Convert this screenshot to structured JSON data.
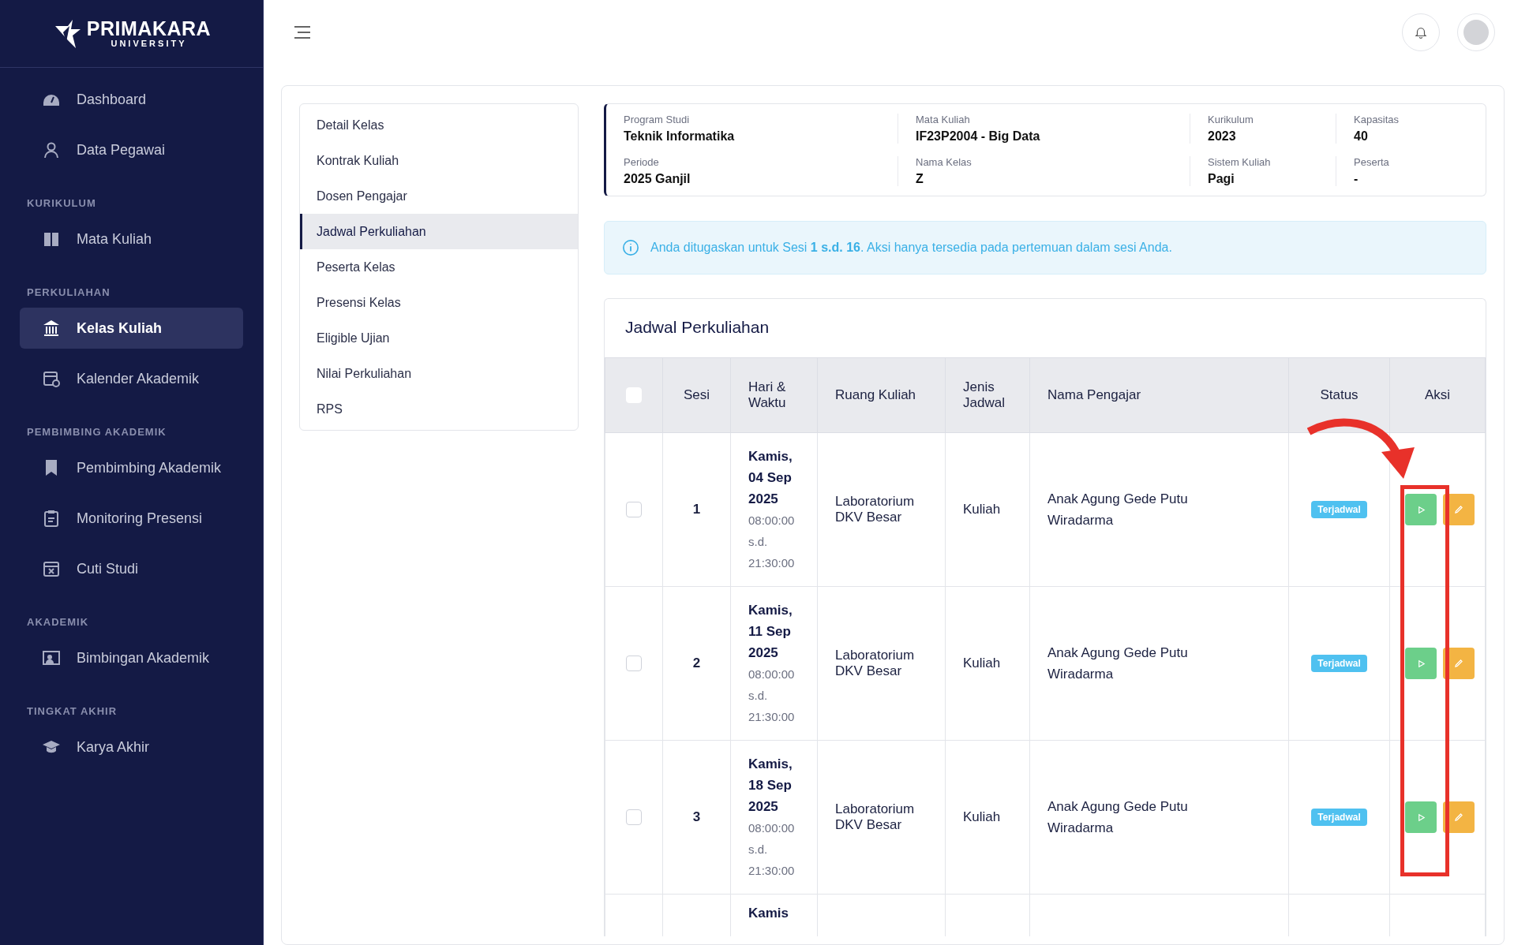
{
  "brand": {
    "name": "PRIMAKARA",
    "subtitle": "UNIVERSITY"
  },
  "sidebar": [
    {
      "items": [
        {
          "label": "Dashboard",
          "kind": "dashboard",
          "selected": false
        },
        {
          "label": "Data Pegawai",
          "kind": "user",
          "selected": false
        }
      ]
    },
    {
      "heading": "KURIKULUM",
      "items": [
        {
          "label": "Mata Kuliah",
          "kind": "book",
          "selected": false
        }
      ]
    },
    {
      "heading": "PERKULIAHAN",
      "items": [
        {
          "label": "Kelas Kuliah",
          "kind": "building",
          "selected": true
        },
        {
          "label": "Kalender Akademik",
          "kind": "calendar",
          "selected": false
        }
      ]
    },
    {
      "heading": "PEMBIMBING AKADEMIK",
      "items": [
        {
          "label": "Pembimbing Akademik",
          "kind": "bookmark",
          "selected": false
        },
        {
          "label": "Monitoring Presensi",
          "kind": "clipboard",
          "selected": false
        },
        {
          "label": "Cuti Studi",
          "kind": "calendar-x",
          "selected": false
        }
      ]
    },
    {
      "heading": "AKADEMIK",
      "items": [
        {
          "label": "Bimbingan Akademik",
          "kind": "board",
          "selected": false
        }
      ]
    },
    {
      "heading": "TINGKAT AKHIR",
      "items": [
        {
          "label": "Karya Akhir",
          "kind": "cap",
          "selected": false
        }
      ]
    }
  ],
  "detail_nav": [
    {
      "label": "Detail Kelas",
      "selected": false
    },
    {
      "label": "Kontrak Kuliah",
      "selected": false
    },
    {
      "label": "Dosen Pengajar",
      "selected": false
    },
    {
      "label": "Jadwal Perkuliahan",
      "selected": true
    },
    {
      "label": "Peserta Kelas",
      "selected": false
    },
    {
      "label": "Presensi Kelas",
      "selected": false
    },
    {
      "label": "Eligible Ujian",
      "selected": false
    },
    {
      "label": "Nilai Perkuliahan",
      "selected": false
    },
    {
      "label": "RPS",
      "selected": false
    }
  ],
  "info": [
    {
      "label": "Program Studi",
      "value": "Teknik Informatika"
    },
    {
      "label": "Mata Kuliah",
      "value": "IF23P2004 - Big Data"
    },
    {
      "label": "Kurikulum",
      "value": "2023"
    },
    {
      "label": "Kapasitas",
      "value": "40"
    },
    {
      "label": "Periode",
      "value": "2025 Ganjil"
    },
    {
      "label": "Nama Kelas",
      "value": "Z"
    },
    {
      "label": "Sistem Kuliah",
      "value": "Pagi"
    },
    {
      "label": "Peserta",
      "value": "-"
    }
  ],
  "alert": {
    "text": "Anda ditugaskan untuk Sesi **1 s.d. 16**. Aksi hanya tersedia pada pertemuan dalam sesi Anda."
  },
  "schedule": {
    "title": "Jadwal Perkuliahan",
    "select_all_checked": false,
    "columns": [
      "Sesi",
      "Hari & Waktu",
      "Ruang Kuliah",
      "Jenis Jadwal",
      "Nama Pengajar",
      "Status",
      "Aksi"
    ],
    "rows": [
      {
        "checked": false,
        "session": "1",
        "date": "Kamis, 04 Sep 2025",
        "time": "08:00:00 s.d. 21:30:00",
        "room": "Laboratorium DKV Besar",
        "type": "Kuliah",
        "lecturer": "Anak Agung Gede Putu Wiradarma",
        "status": {
          "label": "Terjadwal",
          "kind": "scheduled"
        },
        "actions": [
          {
            "kind": "start"
          },
          {
            "kind": "edit"
          }
        ]
      },
      {
        "checked": false,
        "session": "2",
        "date": "Kamis, 11 Sep 2025",
        "time": "08:00:00 s.d. 21:30:00",
        "room": "Laboratorium DKV Besar",
        "type": "Kuliah",
        "lecturer": "Anak Agung Gede Putu Wiradarma",
        "status": {
          "label": "Terjadwal",
          "kind": "scheduled"
        },
        "actions": [
          {
            "kind": "start"
          },
          {
            "kind": "edit"
          }
        ]
      },
      {
        "checked": false,
        "session": "3",
        "date": "Kamis, 18 Sep 2025",
        "time": "08:00:00 s.d. 21:30:00",
        "room": "Laboratorium DKV Besar",
        "type": "Kuliah",
        "lecturer": "Anak Agung Gede Putu Wiradarma",
        "status": {
          "label": "Terjadwal",
          "kind": "scheduled"
        },
        "actions": [
          {
            "kind": "start"
          },
          {
            "kind": "edit"
          }
        ]
      },
      {
        "date": "Kamis"
      }
    ]
  }
}
